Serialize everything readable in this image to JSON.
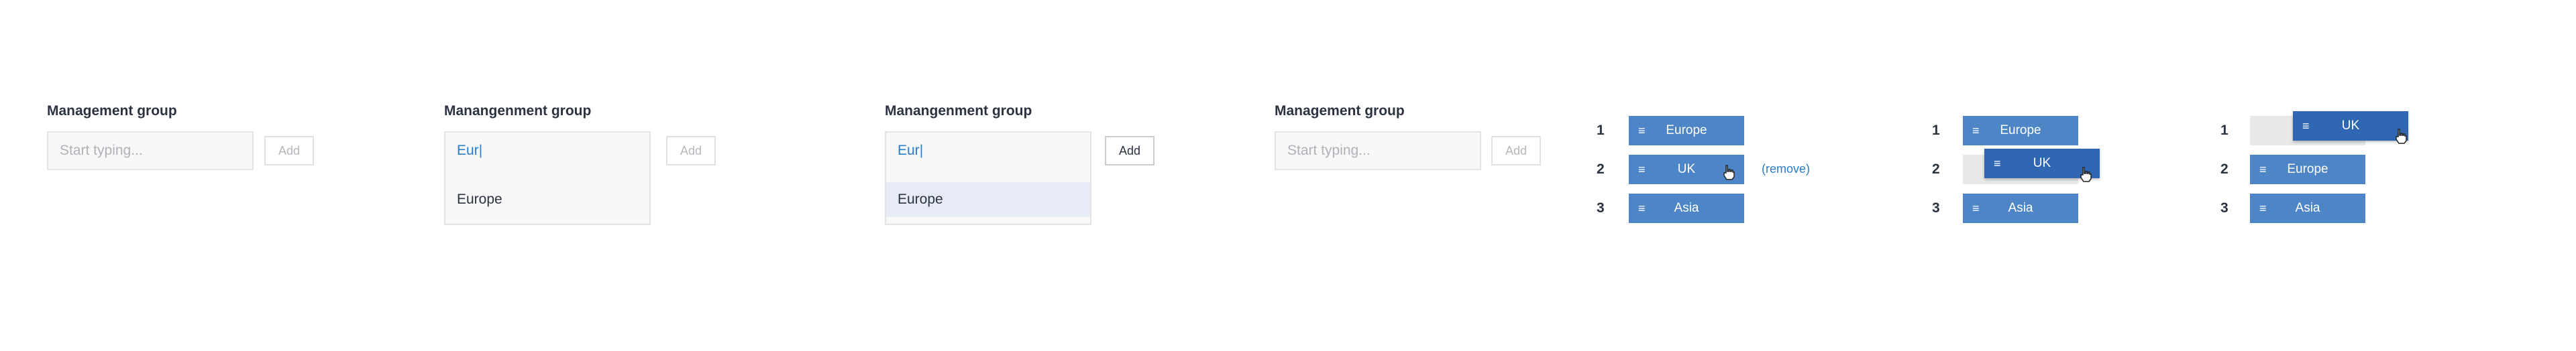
{
  "panel1": {
    "label": "Management group",
    "input_placeholder": "Start typing...",
    "add_label": "Add"
  },
  "panel2": {
    "label": "Manangenment group",
    "input_value": "Eur",
    "add_label": "Add",
    "options": [
      "Europe"
    ]
  },
  "panel3": {
    "label": "Manangenment group",
    "input_value": "Eur",
    "add_label": "Add",
    "options": [
      "Europe"
    ]
  },
  "panel4": {
    "label": "Management group",
    "input_placeholder": "Start typing...",
    "add_label": "Add"
  },
  "list_a": {
    "numbers": [
      "1",
      "2",
      "3"
    ],
    "items": [
      "Europe",
      "UK",
      "Asia"
    ],
    "remove_label": "(remove)"
  },
  "list_b": {
    "numbers": [
      "1",
      "2",
      "3"
    ],
    "items": [
      "Europe",
      "UK",
      "Asia"
    ]
  },
  "list_c": {
    "numbers": [
      "1",
      "2",
      "3"
    ],
    "items": [
      "UK",
      "Europe",
      "Asia"
    ]
  },
  "icons": {
    "grip": "drag-handle-icon",
    "cursor": "hand-cursor-icon"
  },
  "colors": {
    "chip": "#4d85c7",
    "chip_dragging": "#2f67b3",
    "link": "#2a7ccc"
  }
}
